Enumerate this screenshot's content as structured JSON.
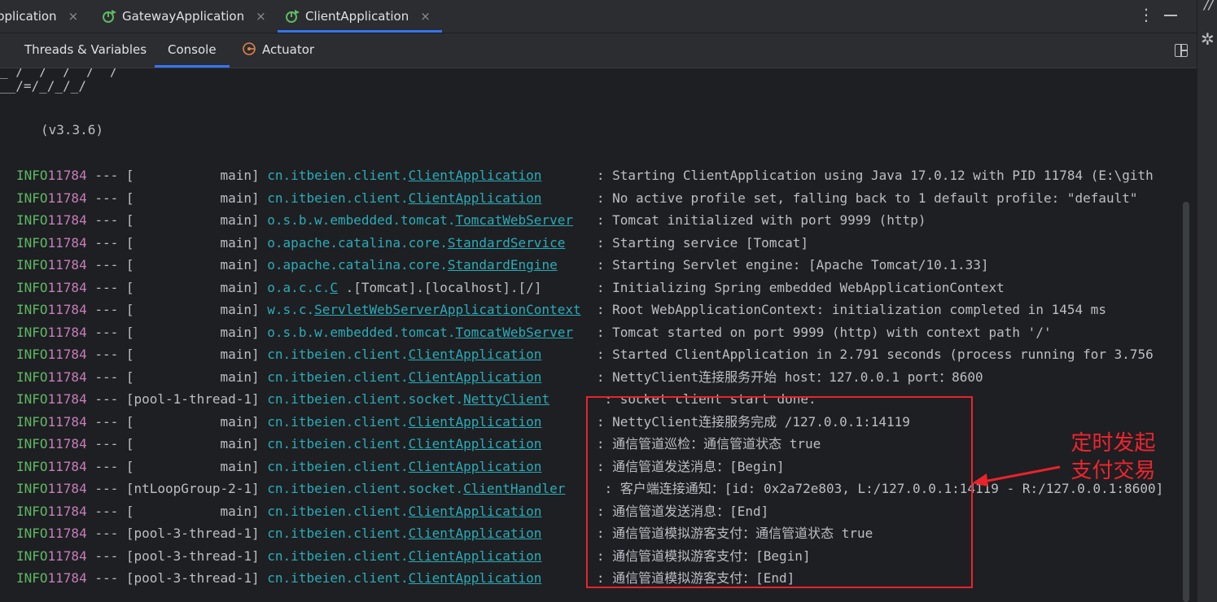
{
  "run_tabs": [
    {
      "label": "pplication",
      "active": false
    },
    {
      "label": "GatewayApplication",
      "active": false
    },
    {
      "label": "ClientApplication",
      "active": true
    }
  ],
  "tab_close_glyph": "×",
  "tabbar_more_glyph": "⋮",
  "tool_strip_glyphs": [
    "//",
    "✲"
  ],
  "sub_tabs": [
    {
      "label": "Threads & Variables",
      "active": false
    },
    {
      "label": "Console",
      "active": true
    },
    {
      "label": "Actuator",
      "active": false
    }
  ],
  "banner_lines": [
    "_ /  /  /  /  /",
    "__/=/_/_/_/"
  ],
  "version": "(v3.3.6)",
  "log_lines": [
    {
      "level": "INFO",
      "pid": "11784",
      "dash": " --- ",
      "thread": "[           main]",
      "pkg": "cn.itbeien.client.",
      "cls": "ClientApplication",
      "pad": "      ",
      "msg": ": Starting ClientApplication using Java 17.0.12 with PID 11784 (E:\\gith"
    },
    {
      "level": "INFO",
      "pid": "11784",
      "dash": " --- ",
      "thread": "[           main]",
      "pkg": "cn.itbeien.client.",
      "cls": "ClientApplication",
      "pad": "      ",
      "msg": ": No active profile set, falling back to 1 default profile: \"default\""
    },
    {
      "level": "INFO",
      "pid": "11784",
      "dash": " --- ",
      "thread": "[           main]",
      "pkg": "o.s.b.w.embedded.tomcat.",
      "cls": "TomcatWebServer",
      "pad": "  ",
      "msg": ": Tomcat initialized with port 9999 (http)"
    },
    {
      "level": "INFO",
      "pid": "11784",
      "dash": " --- ",
      "thread": "[           main]",
      "pkg": "o.apache.catalina.core.",
      "cls": "StandardService",
      "pad": "   ",
      "msg": ": Starting service [Tomcat]"
    },
    {
      "level": "INFO",
      "pid": "11784",
      "dash": " --- ",
      "thread": "[           main]",
      "pkg": "o.apache.catalina.core.",
      "cls": "StandardEngine",
      "pad": "    ",
      "msg": ": Starting Servlet engine: [Apache Tomcat/10.1.33]"
    },
    {
      "level": "INFO",
      "pid": "11784",
      "dash": " --- ",
      "thread": "[           main]",
      "pkg": "o.a.c.c.",
      "cls": "C",
      "pad": "",
      "msg": ".[Tomcat].[localhost].[/]       : Initializing Spring embedded WebApplicationContext"
    },
    {
      "level": "INFO",
      "pid": "11784",
      "dash": " --- ",
      "thread": "[           main]",
      "pkg": "w.s.c.",
      "cls": "ServletWebServerApplicationContext",
      "pad": " ",
      "msg": ": Root WebApplicationContext: initialization completed in 1454 ms"
    },
    {
      "level": "INFO",
      "pid": "11784",
      "dash": " --- ",
      "thread": "[           main]",
      "pkg": "o.s.b.w.embedded.tomcat.",
      "cls": "TomcatWebServer",
      "pad": "  ",
      "msg": ": Tomcat started on port 9999 (http) with context path '/'"
    },
    {
      "level": "INFO",
      "pid": "11784",
      "dash": " --- ",
      "thread": "[           main]",
      "pkg": "cn.itbeien.client.",
      "cls": "ClientApplication",
      "pad": "      ",
      "msg": ": Started ClientApplication in 2.791 seconds (process running for 3.756"
    },
    {
      "level": "INFO",
      "pid": "11784",
      "dash": " --- ",
      "thread": "[           main]",
      "pkg": "cn.itbeien.client.",
      "cls": "ClientApplication",
      "pad": "      ",
      "msg": ": NettyClient连接服务开始 host：127.0.0.1 port：8600"
    },
    {
      "level": "INFO",
      "pid": "11784",
      "dash": " --- ",
      "thread": "[pool-1-thread-1]",
      "pkg": "cn.itbeien.client.socket.",
      "cls": "NettyClient",
      "pad": "      ",
      "msg": ": socket client start done."
    },
    {
      "level": "INFO",
      "pid": "11784",
      "dash": " --- ",
      "thread": "[           main]",
      "pkg": "cn.itbeien.client.",
      "cls": "ClientApplication",
      "pad": "      ",
      "msg": ": NettyClient连接服务完成 /127.0.0.1:14119"
    },
    {
      "level": "INFO",
      "pid": "11784",
      "dash": " --- ",
      "thread": "[           main]",
      "pkg": "cn.itbeien.client.",
      "cls": "ClientApplication",
      "pad": "      ",
      "msg": ": 通信管道巡检：通信管道状态 true"
    },
    {
      "level": "INFO",
      "pid": "11784",
      "dash": " --- ",
      "thread": "[           main]",
      "pkg": "cn.itbeien.client.",
      "cls": "ClientApplication",
      "pad": "      ",
      "msg": ": 通信管道发送消息：[Begin]"
    },
    {
      "level": "INFO",
      "pid": "11784",
      "dash": " --- ",
      "thread": "[ntLoopGroup-2-1]",
      "pkg": "cn.itbeien.client.socket.",
      "cls": "ClientHandler",
      "pad": "    ",
      "msg": ": 客户端连接通知：[id: 0x2a72e803, L:/127.0.0.1:14119 - R:/127.0.0.1:8600]"
    },
    {
      "level": "INFO",
      "pid": "11784",
      "dash": " --- ",
      "thread": "[           main]",
      "pkg": "cn.itbeien.client.",
      "cls": "ClientApplication",
      "pad": "      ",
      "msg": ": 通信管道发送消息：[End]"
    },
    {
      "level": "INFO",
      "pid": "11784",
      "dash": " --- ",
      "thread": "[pool-3-thread-1]",
      "pkg": "cn.itbeien.client.",
      "cls": "ClientApplication",
      "pad": "      ",
      "msg": ": 通信管道模拟游客支付：通信管道状态 true"
    },
    {
      "level": "INFO",
      "pid": "11784",
      "dash": " --- ",
      "thread": "[pool-3-thread-1]",
      "pkg": "cn.itbeien.client.",
      "cls": "ClientApplication",
      "pad": "      ",
      "msg": ": 通信管道模拟游客支付：[Begin]"
    },
    {
      "level": "INFO",
      "pid": "11784",
      "dash": " --- ",
      "thread": "[pool-3-thread-1]",
      "pkg": "cn.itbeien.client.",
      "cls": "ClientApplication",
      "pad": "      ",
      "msg": ": 通信管道模拟游客支付：[End]"
    }
  ],
  "annotation": {
    "line1": "定时发起",
    "line2": "支付交易",
    "color": "#e8232b"
  },
  "colors": {
    "accent": "#3574f0",
    "info": "#5fb865",
    "pid": "#c77dbb",
    "logger": "#2aacb8"
  }
}
